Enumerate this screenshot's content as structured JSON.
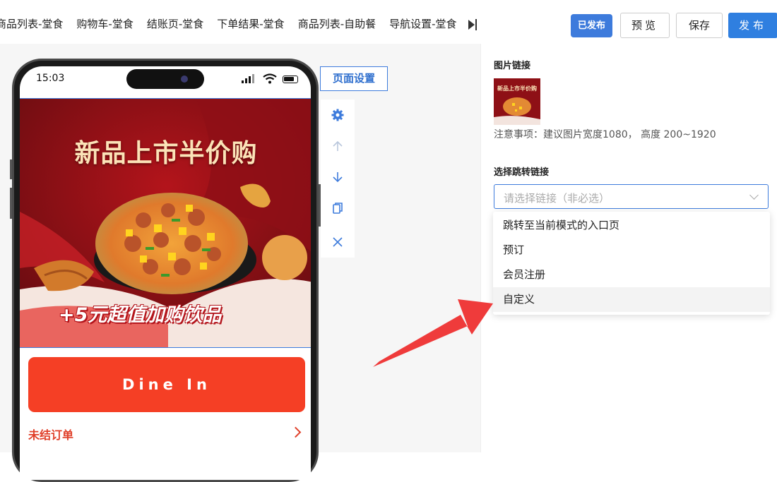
{
  "tabs": [
    {
      "label": "商品列表-堂食"
    },
    {
      "label": "购物车-堂食"
    },
    {
      "label": "结账页-堂食"
    },
    {
      "label": "下单结果-堂食"
    },
    {
      "label": "商品列表-自助餐"
    },
    {
      "label": "导航设置-堂食"
    }
  ],
  "header": {
    "status_badge": "已发布",
    "preview_label": "预览",
    "save_label": "保存",
    "publish_label": "发布"
  },
  "phone": {
    "time": "15:03",
    "banner": {
      "title": "新品上市半价购",
      "promo": "+5元超值加购饮品"
    },
    "dine_in_label": "Dine In",
    "orders_label": "未结订单"
  },
  "page_settings_label": "页面设置",
  "toolbar": {
    "items": [
      "gear-icon",
      "arrow-up-icon",
      "arrow-down-icon",
      "copy-icon",
      "close-icon"
    ]
  },
  "panel": {
    "image_link_label": "图片链接",
    "thumbnail_title": "新品上市半价购",
    "note": "注意事项：建议图片宽度1080， 高度 200~1920",
    "jump_link_label": "选择跳转链接",
    "select_placeholder": "请选择链接（非必选）",
    "options": [
      {
        "label": "跳转至当前模式的入口页"
      },
      {
        "label": "预订"
      },
      {
        "label": "会员注册"
      },
      {
        "label": "自定义"
      }
    ],
    "hovered_option": "自定义"
  },
  "colors": {
    "accent": "#3d7bdc",
    "publish": "#2f7fe0",
    "dine_in": "#f53f25",
    "orders": "#e0402a",
    "annotation_arrow": "#ef3b3b"
  }
}
